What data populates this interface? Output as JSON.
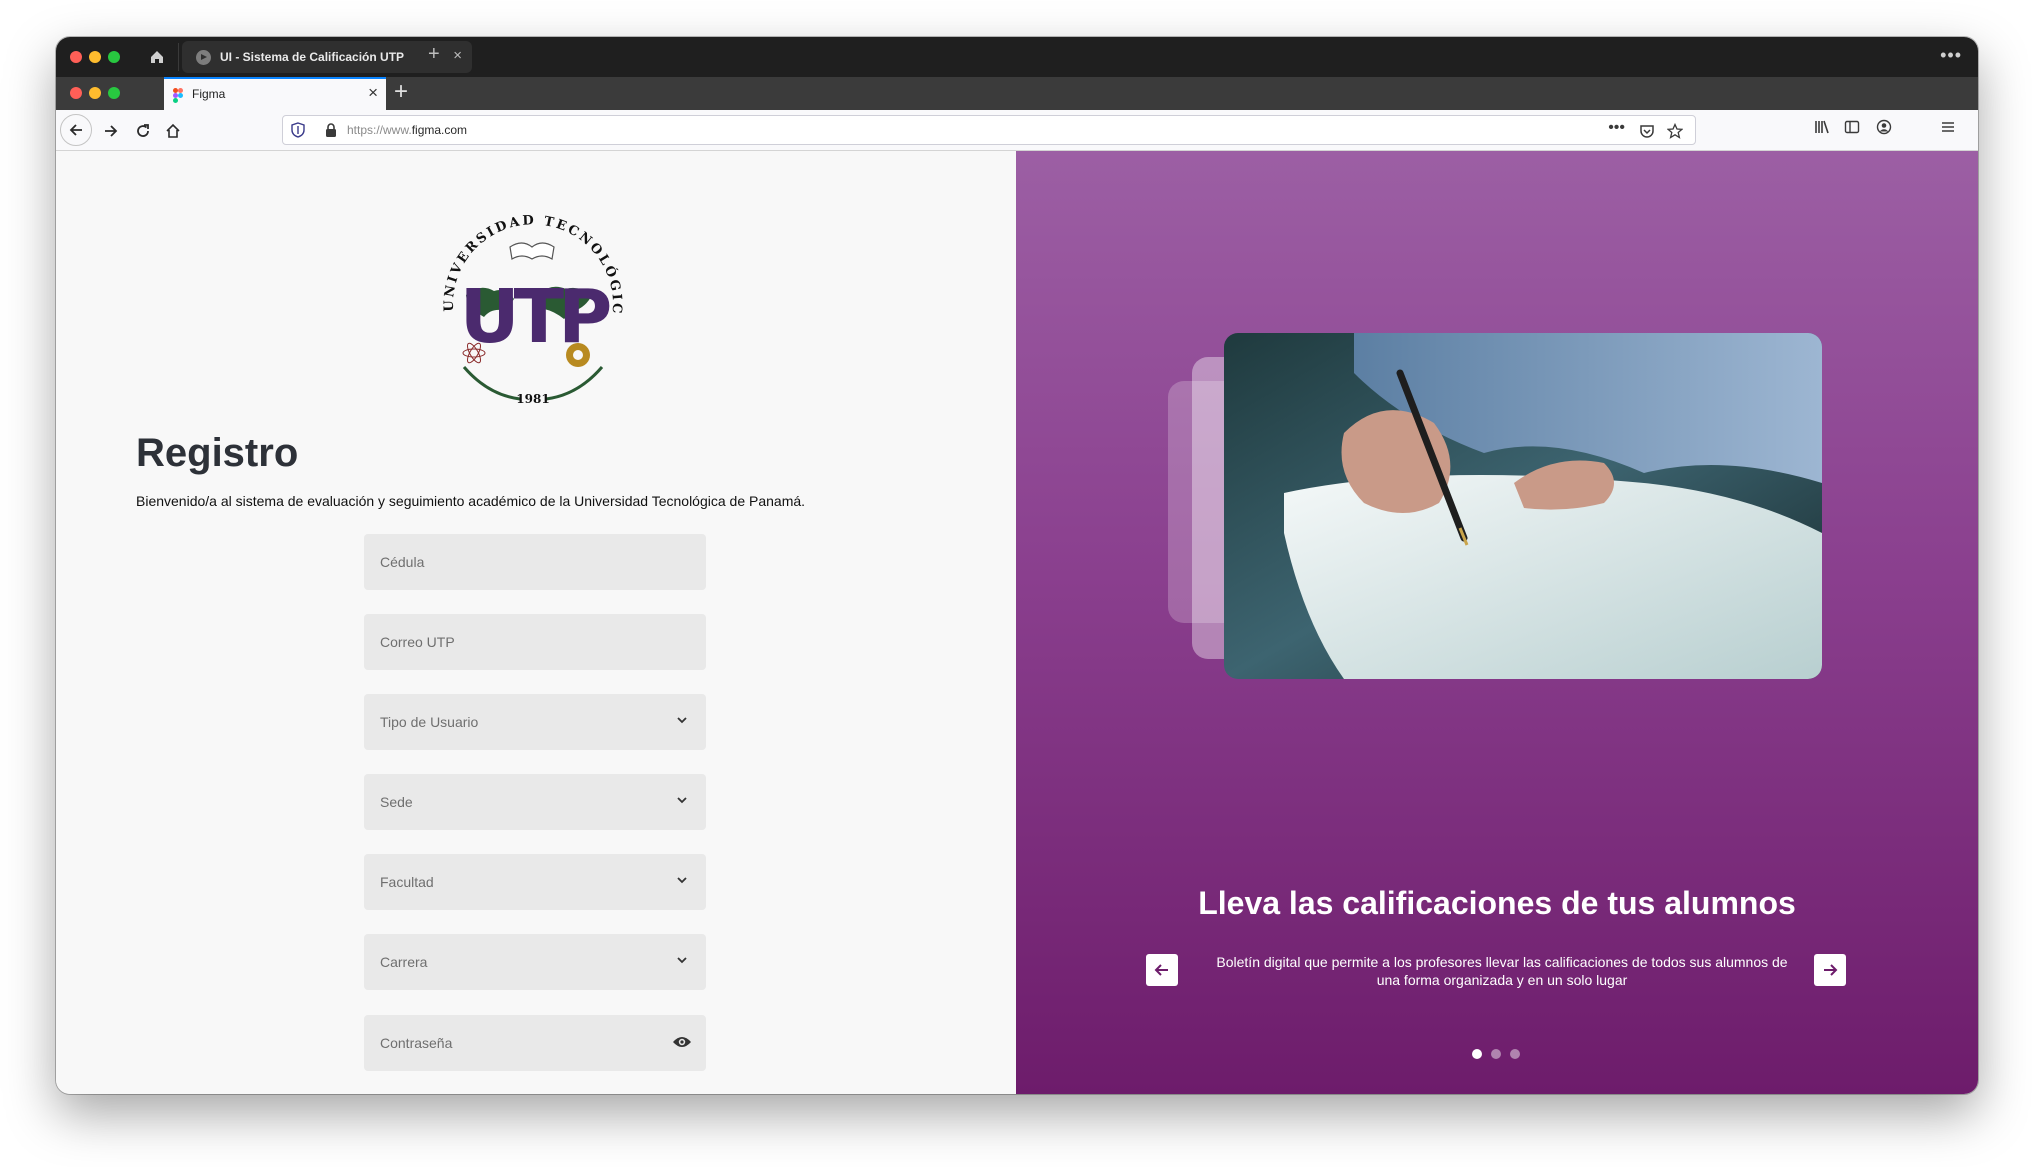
{
  "os_window": {
    "tab_title": "UI - Sistema de Calificación UTP",
    "tab_close": "×",
    "new_tab": "+",
    "more": "•••"
  },
  "browser": {
    "tab_title": "Figma",
    "tab_close": "×",
    "new_tab": "+",
    "url_scheme": "https://www.",
    "url_host": "figma.com",
    "page_actions": "•••"
  },
  "logo": {
    "arc_text": "UNIVERSIDAD TECNOLÓGICA DE PANAMÁ",
    "monogram": "UTP",
    "year": "1981"
  },
  "form": {
    "title": "Registro",
    "subtitle": "Bienvenido/a al sistema de evaluación y seguimiento académico de la Universidad Tecnológica de Panamá.",
    "fields": {
      "cedula": "Cédula",
      "correo": "Correo UTP",
      "tipo_usuario": "Tipo de Usuario",
      "sede": "Sede",
      "facultad": "Facultad",
      "carrera": "Carrera",
      "contrasena": "Contraseña"
    }
  },
  "carousel": {
    "headline": "Lleva las calificaciones de tus alumnos",
    "description": "Boletín digital que permite a los profesores llevar las calificaciones de todos sus alumnos de una forma organizada y en un solo lugar",
    "total_slides": 3,
    "active_slide": 1
  },
  "colors": {
    "accent_purple": "#4b2a6e",
    "carousel_top": "#9c5fa4",
    "carousel_bottom": "#6d1c6b",
    "field_bg": "#e9e9e9"
  }
}
